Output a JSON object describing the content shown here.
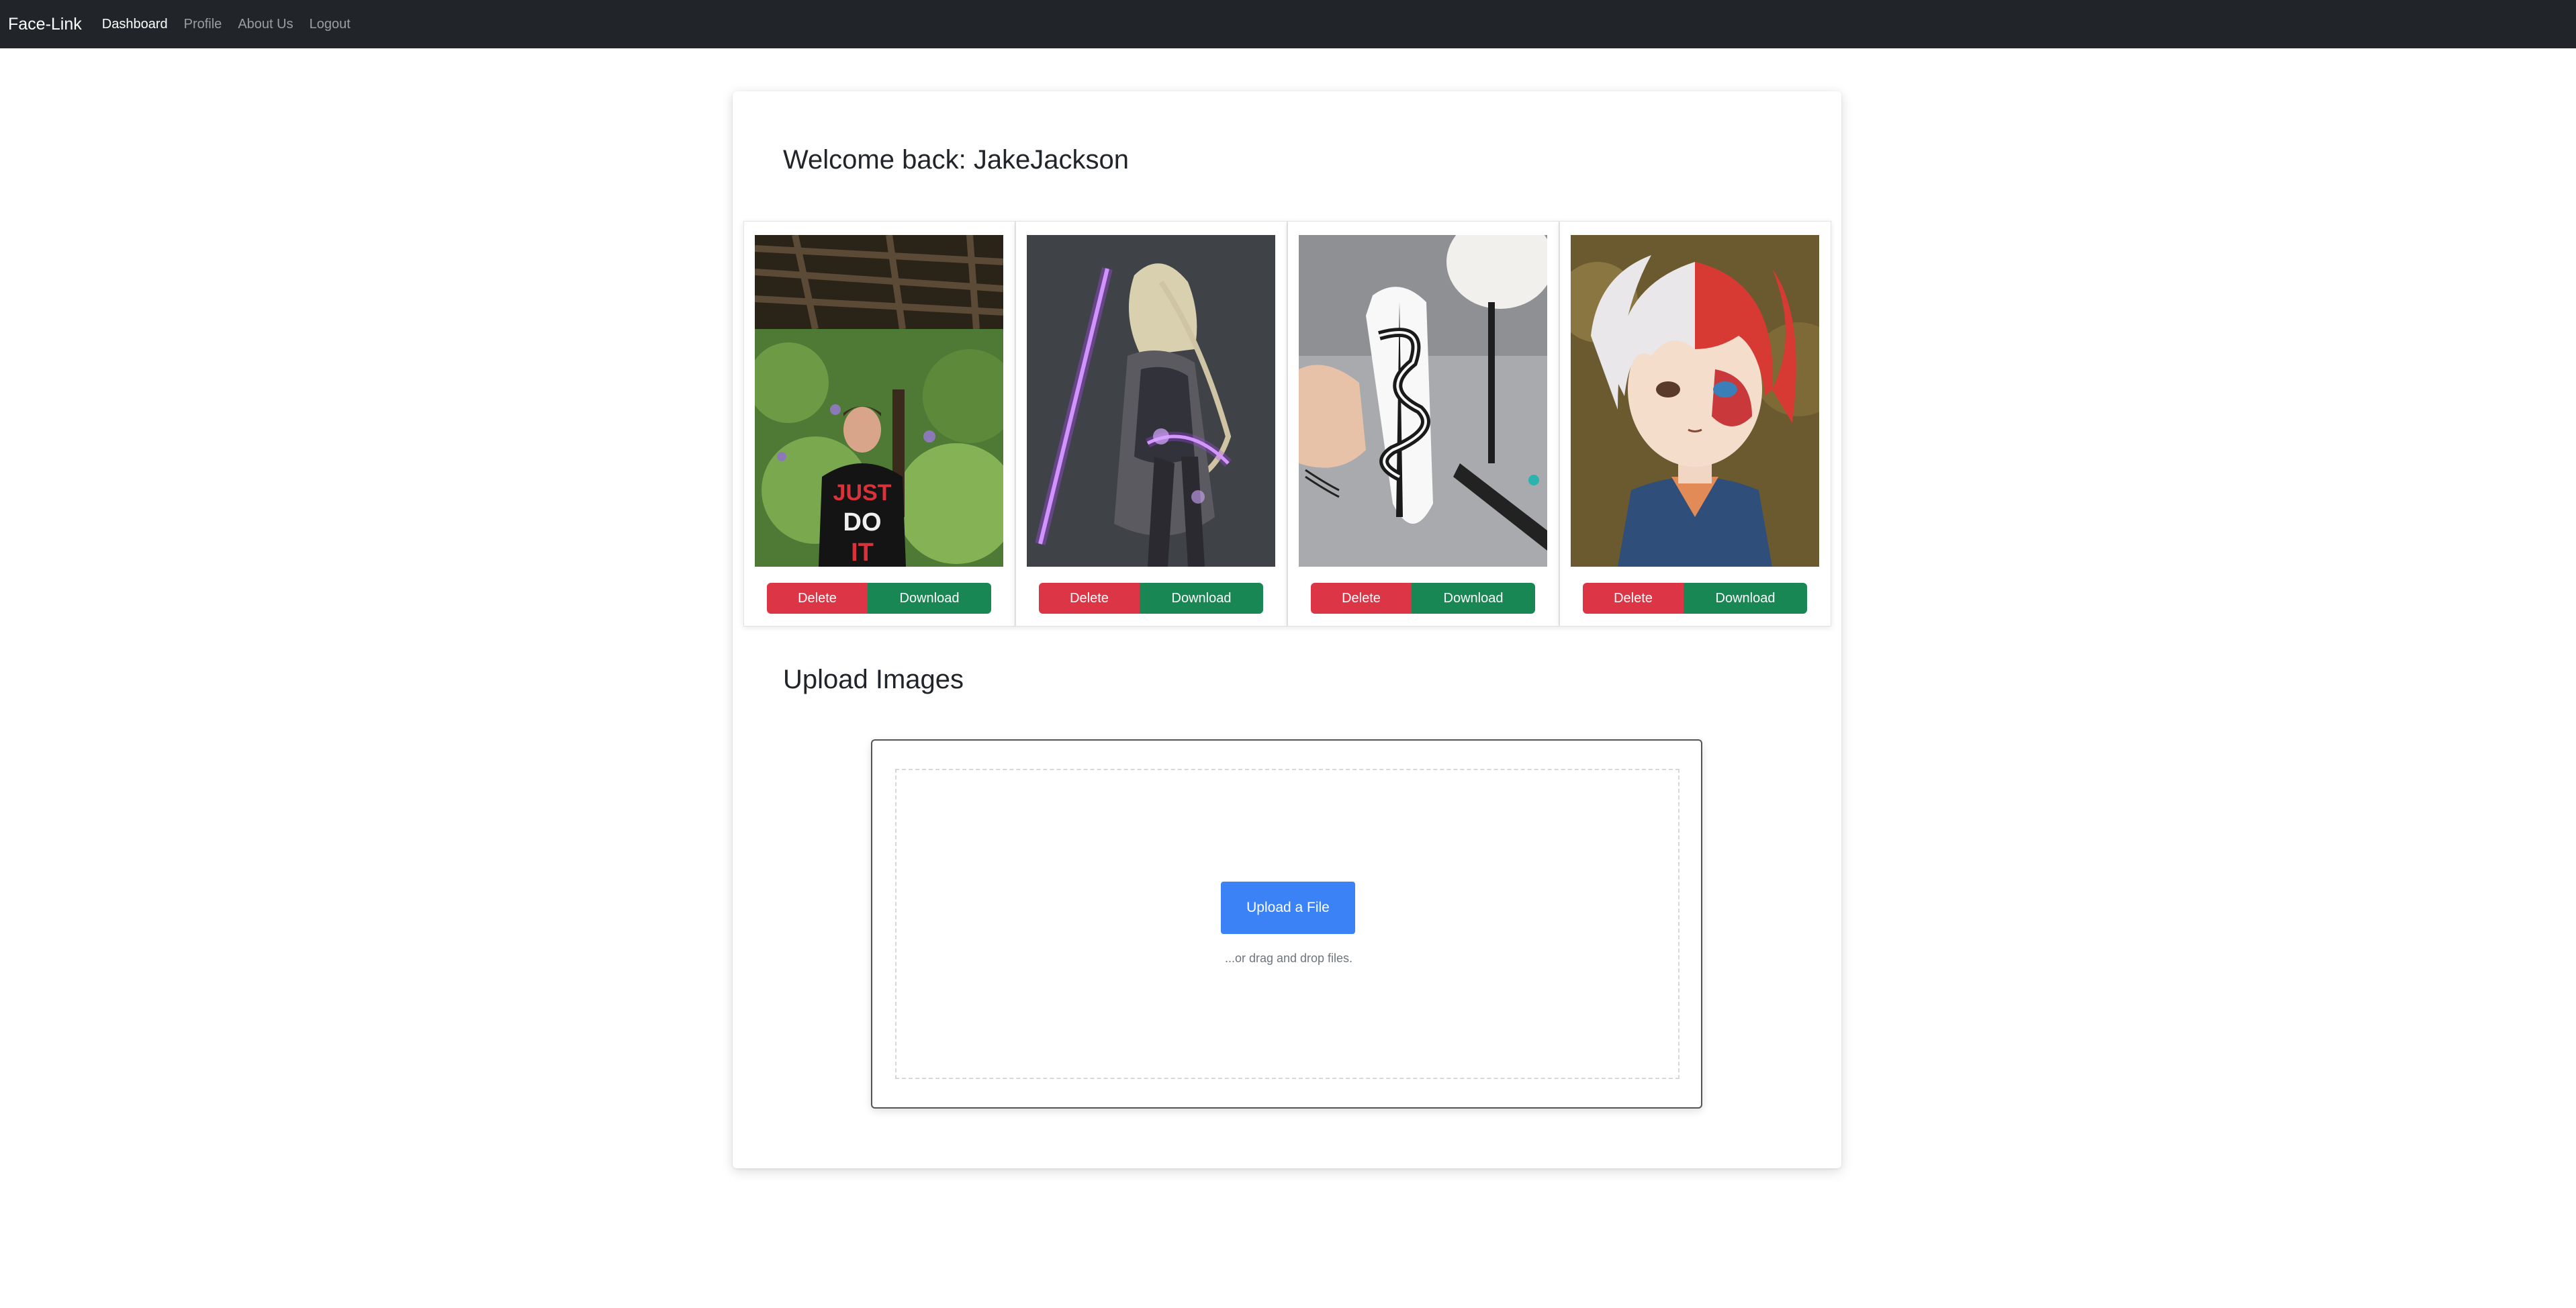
{
  "navbar": {
    "brand": "Face-Link",
    "links": [
      {
        "label": "Dashboard",
        "active": true
      },
      {
        "label": "Profile",
        "active": false
      },
      {
        "label": "About Us",
        "active": false
      },
      {
        "label": "Logout",
        "active": false
      }
    ]
  },
  "dashboard": {
    "welcome_prefix": "Welcome back: ",
    "username": "JakeJackson"
  },
  "images": [
    {
      "delete_label": "Delete",
      "download_label": "Download"
    },
    {
      "delete_label": "Delete",
      "download_label": "Download"
    },
    {
      "delete_label": "Delete",
      "download_label": "Download"
    },
    {
      "delete_label": "Delete",
      "download_label": "Download"
    }
  ],
  "upload": {
    "heading": "Upload Images",
    "button_label": "Upload a File",
    "hint": "...or drag and drop files."
  },
  "colors": {
    "navbar": "#212529",
    "delete": "#dc3545",
    "download": "#198754",
    "upload_button": "#3b82f6"
  }
}
